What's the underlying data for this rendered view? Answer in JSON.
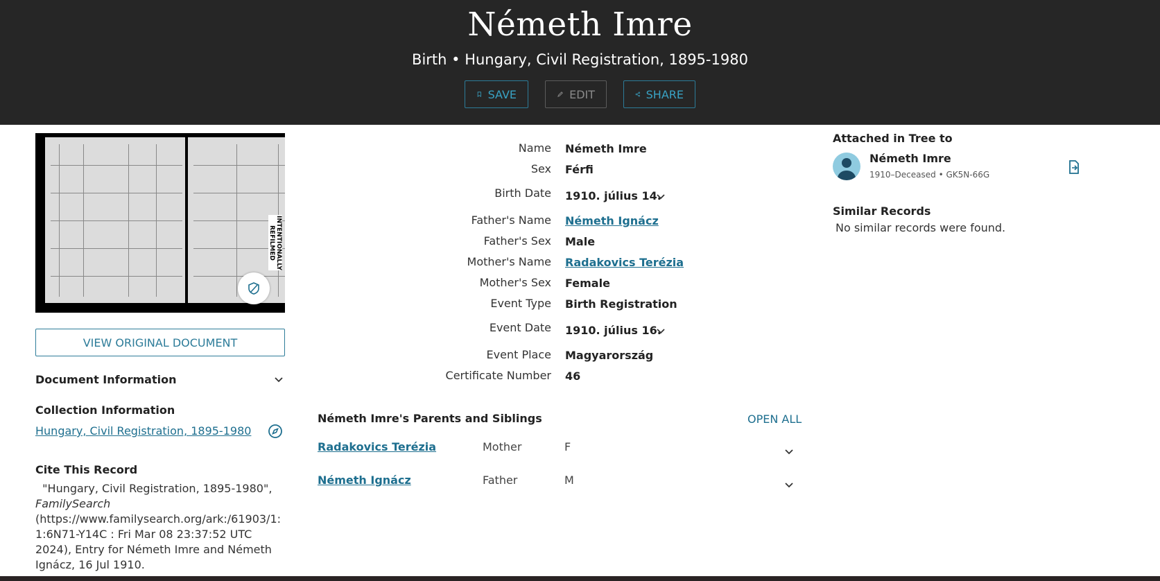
{
  "header": {
    "title": "Németh Imre",
    "subtitle": "Birth • Hungary, Civil Registration, 1895-1980",
    "save_label": "SAVE",
    "edit_label": "EDIT",
    "share_label": "SHARE"
  },
  "left": {
    "view_original": "VIEW ORIGINAL DOCUMENT",
    "image_tab_text": "INTENTIONALLY REFILMED",
    "document_info": "Document Information",
    "collection_info": "Collection Information",
    "collection_link": "Hungary, Civil Registration, 1895-1980",
    "cite_title": "Cite This Record",
    "cite_part1": "\"Hungary, Civil Registration, 1895-1980\",",
    "cite_source": "FamilySearch",
    "cite_part2": "(https://www.familysearch.org/ark:/61903/1:1:6N71-Y14C : Fri Mar 08 23:37:52 UTC 2024), Entry for Németh Imre and Németh Ignácz, 16 Jul 1910."
  },
  "record": {
    "name_label": "Name",
    "name": "Németh Imre",
    "sex_label": "Sex",
    "sex": "Férfi",
    "birth_date_label": "Birth Date",
    "birth_date": "1910. július 14.",
    "father_name_label": "Father's Name",
    "father_name": "Németh Ignácz",
    "father_sex_label": "Father's Sex",
    "father_sex": "Male",
    "mother_name_label": "Mother's Name",
    "mother_name": "Radakovics Terézia",
    "mother_sex_label": "Mother's Sex",
    "mother_sex": "Female",
    "event_type_label": "Event Type",
    "event_type": "Birth Registration",
    "event_date_label": "Event Date",
    "event_date": "1910. július 16.",
    "event_place_label": "Event Place",
    "event_place": "Magyarország",
    "cert_label": "Certificate Number",
    "cert": "46"
  },
  "family": {
    "title": "Németh Imre's Parents and Siblings",
    "open_all": "OPEN ALL",
    "members": [
      {
        "name": "Radakovics Terézia",
        "role": "Mother",
        "sex": "F"
      },
      {
        "name": "Németh Ignácz",
        "role": "Father",
        "sex": "M"
      }
    ]
  },
  "right": {
    "attached_title": "Attached in Tree to",
    "person_name": "Németh Imre",
    "person_meta": "1910–Deceased • GK5N-66G",
    "similar_title": "Similar Records",
    "similar_text": "No similar records were found."
  },
  "colors": {
    "header_bg": "#262626",
    "accent": "#2d7c99",
    "link": "#1e6f8f"
  }
}
